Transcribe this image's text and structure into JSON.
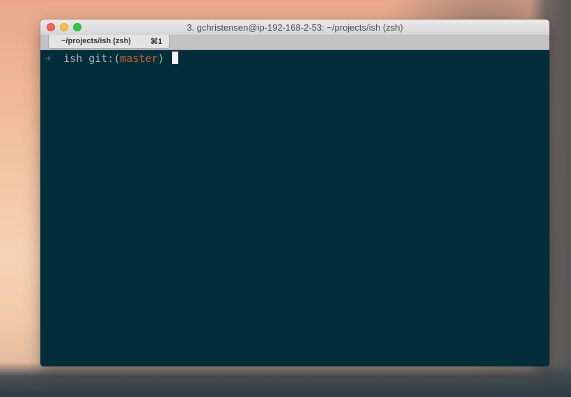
{
  "window": {
    "title": "3. gchristensen@ip-192-168-2-53: ~/projects/ish (zsh)"
  },
  "tabs": [
    {
      "label": "~/projects/ish (zsh)",
      "shortcut": "⌘1"
    }
  ],
  "terminal": {
    "prompt_arrow": "➜",
    "directory": "ish",
    "git_prefix": "git:(",
    "branch": "master",
    "git_suffix": ")"
  },
  "colors": {
    "terminal_bg": "#022e3c",
    "branch": "#d4622b",
    "text": "#a9b7b8",
    "arrow": "#4f6e75"
  }
}
